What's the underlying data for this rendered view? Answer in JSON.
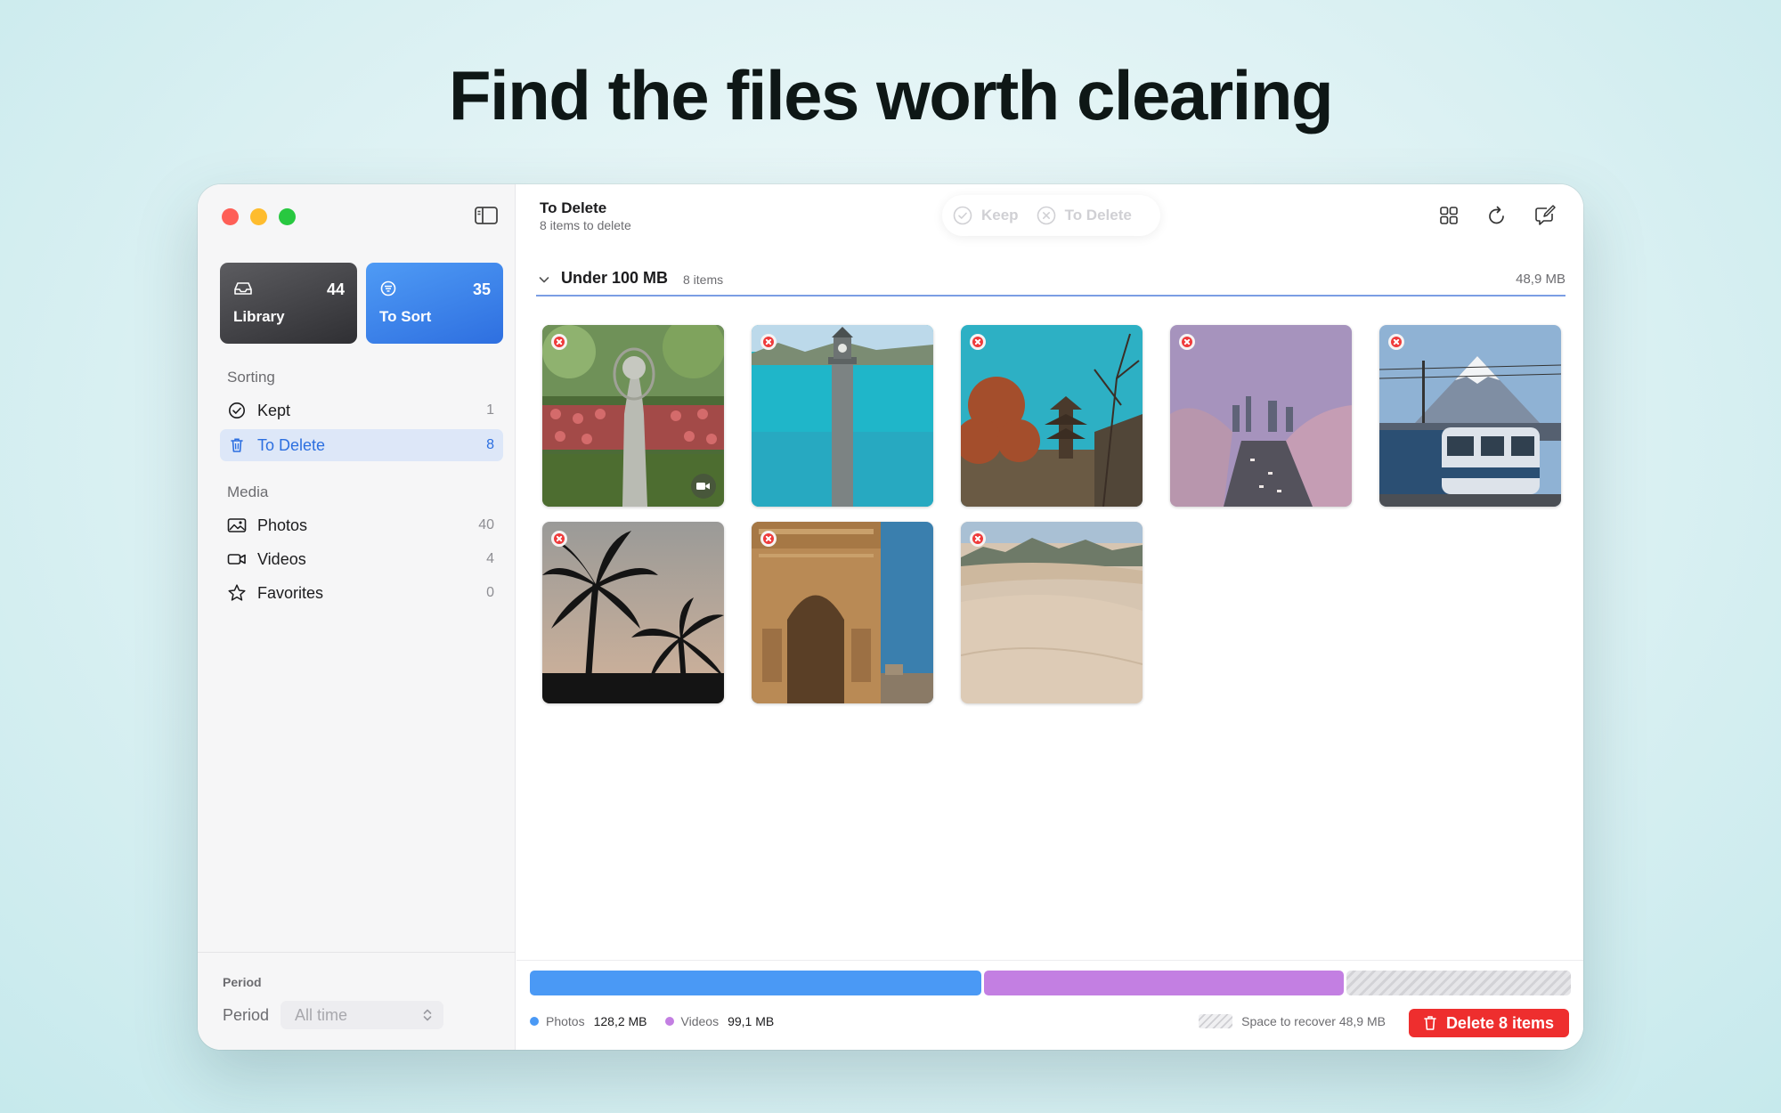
{
  "headline": "Find the files worth clearing",
  "sidebar": {
    "cards": [
      {
        "label": "Library",
        "count": "44",
        "icon": "tray-icon"
      },
      {
        "label": "To Sort",
        "count": "35",
        "icon": "sort-icon"
      }
    ],
    "sorting_title": "Sorting",
    "sorting_items": [
      {
        "label": "Kept",
        "count": "1",
        "icon": "checkmark-circle-icon"
      },
      {
        "label": "To Delete",
        "count": "8",
        "icon": "trash-icon",
        "active": true
      }
    ],
    "media_title": "Media",
    "media_items": [
      {
        "label": "Photos",
        "count": "40",
        "icon": "photo-icon"
      },
      {
        "label": "Videos",
        "count": "4",
        "icon": "video-icon"
      },
      {
        "label": "Favorites",
        "count": "0",
        "icon": "star-icon"
      }
    ],
    "footer": {
      "section_title": "Period",
      "period_label": "Period",
      "period_value": "All time"
    }
  },
  "main": {
    "title": "To Delete",
    "subtitle": "8 items to delete",
    "actions": {
      "keep": "Keep",
      "to_delete": "To Delete"
    },
    "group": {
      "title": "Under 100 MB",
      "count": "8 items",
      "size": "48,9 MB"
    },
    "tiles": [
      {
        "scene": "statue",
        "video": true
      },
      {
        "scene": "lake-tower",
        "video": false
      },
      {
        "scene": "pagoda",
        "video": false
      },
      {
        "scene": "blossom-river",
        "video": false
      },
      {
        "scene": "train-fuji",
        "video": false
      },
      {
        "scene": "palms",
        "video": false
      },
      {
        "scene": "arch",
        "video": false
      },
      {
        "scene": "dunes",
        "video": false
      }
    ],
    "storage": {
      "photos_label": "Photos",
      "photos_size": "128,2 MB",
      "photos_fraction": 0.436,
      "videos_label": "Videos",
      "videos_size": "99,1 MB",
      "videos_fraction": 0.347,
      "recover_text": "Space to recover 48,9 MB",
      "delete_button": "Delete 8 items"
    }
  },
  "colors": {
    "accent": "#2c6fe0",
    "photos": "#4a99f5",
    "videos": "#c37fe2",
    "danger": "#ee2e2e"
  }
}
